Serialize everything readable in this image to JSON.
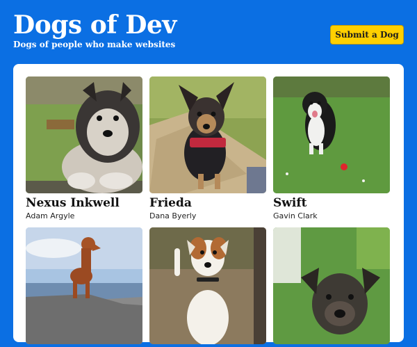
{
  "header": {
    "title": "Dogs of Dev",
    "tagline": "Dogs of people who make websites",
    "submit_label": "Submit a Dog"
  },
  "dogs": [
    {
      "name": "Nexus Inkwell",
      "owner": "Adam Argyle"
    },
    {
      "name": "Frieda",
      "owner": "Dana Byerly"
    },
    {
      "name": "Swift",
      "owner": "Gavin Clark"
    },
    {
      "name": "",
      "owner": ""
    },
    {
      "name": "",
      "owner": ""
    },
    {
      "name": "",
      "owner": ""
    }
  ],
  "colors": {
    "background": "#0b6fe3",
    "button": "#ffd000",
    "card": "#ffffff"
  }
}
